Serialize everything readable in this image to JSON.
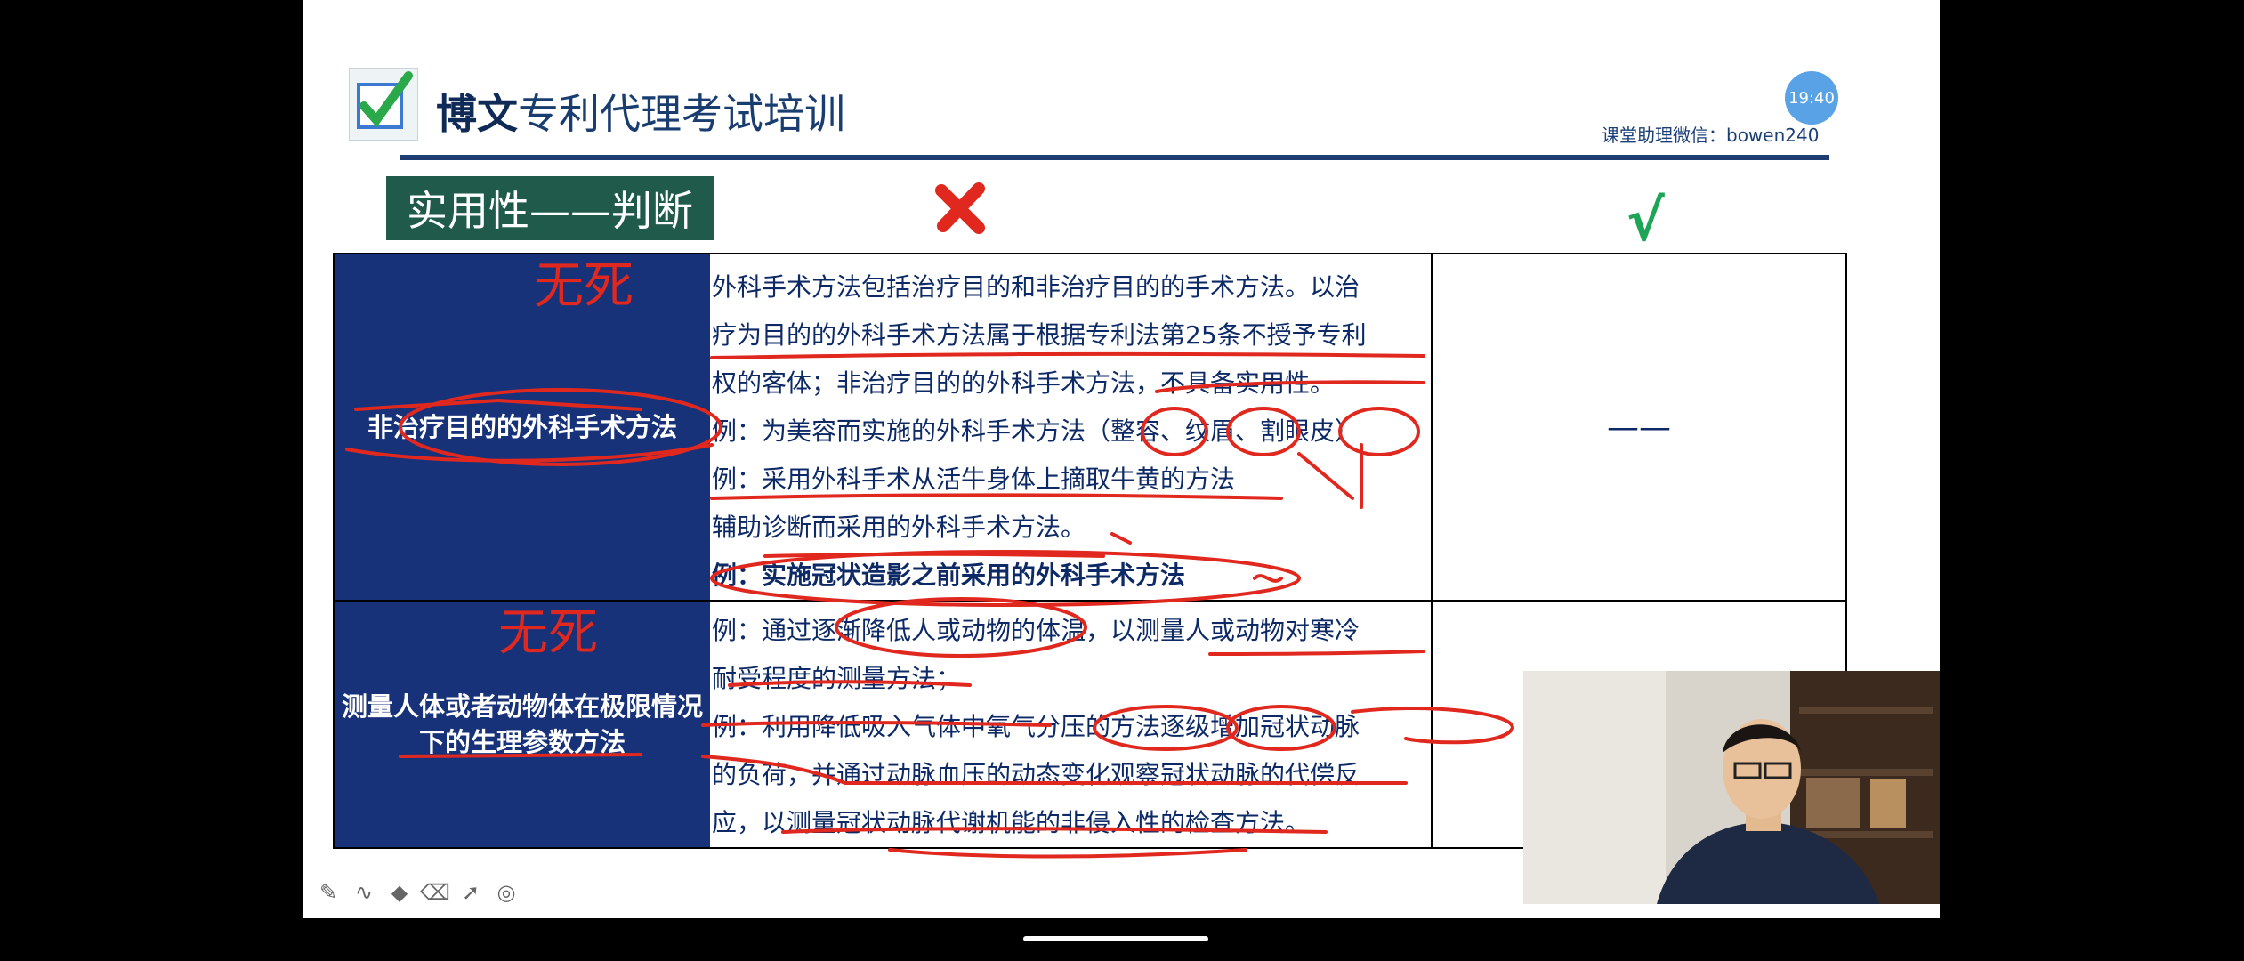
{
  "header": {
    "brand_bold": "博文",
    "brand_rest": "专利代理考试培训",
    "wechat": "课堂助理微信：bowen240",
    "timer": "19:40"
  },
  "slide": {
    "title": "实用性——判断",
    "right_dash": "——"
  },
  "table": {
    "rows": [
      {
        "category": "非治疗目的的外科手术方法",
        "lines": [
          "外科手术方法包括治疗目的和非治疗目的的手术方法。以治",
          "疗为目的的外科手术方法属于根据专利法第25条不授予专利",
          "权的客体；非治疗目的的外科手术方法，不具备实用性。",
          "例：为美容而实施的外科手术方法（整容、纹眉、割眼皮）",
          "例：采用外科手术从活牛身体上摘取牛黄的方法",
          "辅助诊断而采用的外科手术方法。",
          "例：实施冠状造影之前采用的外科手术方法"
        ]
      },
      {
        "category": "测量人体或者动物体在极限情况下的生理参数方法",
        "lines": [
          "例：通过逐渐降低人或动物的体温，以测量人或动物对寒冷",
          "耐受程度的测量方法；",
          "例：利用降低吸入气体中氧气分压的方法逐级增加冠状动脉",
          "的负荷，并通过动脉血压的动态变化观察冠状动脉的代偿反",
          "应，以测量冠状动脉代谢机能的非侵入性的检查方法。"
        ]
      }
    ]
  },
  "handwriting": {
    "note1": "无死",
    "note2": "无死"
  },
  "icons": {
    "cross": "red-x-icon",
    "tick": "green-check-icon"
  },
  "colors": {
    "header_blue": "#1e3d73",
    "category_bg": "#18327a",
    "title_bg": "#1f5a4a",
    "annotation_red": "#e0281e"
  }
}
